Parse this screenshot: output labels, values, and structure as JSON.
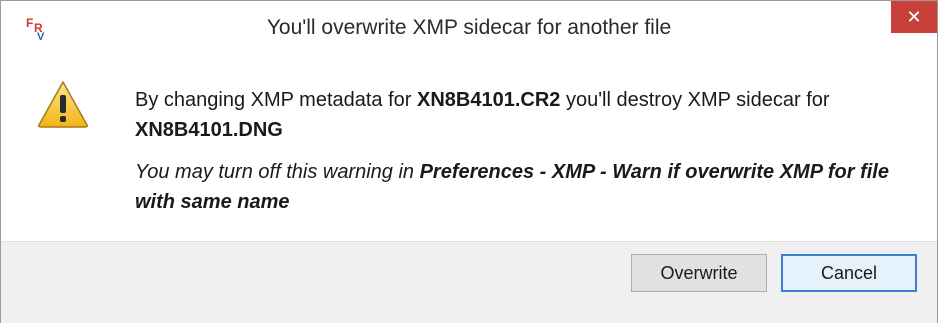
{
  "window": {
    "title": "You'll overwrite XMP sidecar for another file",
    "app_icon": "fastrawviewer-logo-icon",
    "close_icon": "close-icon",
    "close_glyph": "✕",
    "close_color": "#c7403a"
  },
  "message": {
    "icon": "warning-icon",
    "line1_prefix": "By changing XMP metadata for ",
    "file_source": "XN8B4101.CR2",
    "line1_middle": " you'll destroy XMP sidecar for ",
    "file_target": "XN8B4101.DNG",
    "hint_prefix": "You may turn off this warning in ",
    "hint_setting": "Preferences - XMP - Warn if overwrite XMP for file with same name"
  },
  "buttons": {
    "overwrite_label": "Overwrite",
    "cancel_label": "Cancel"
  }
}
